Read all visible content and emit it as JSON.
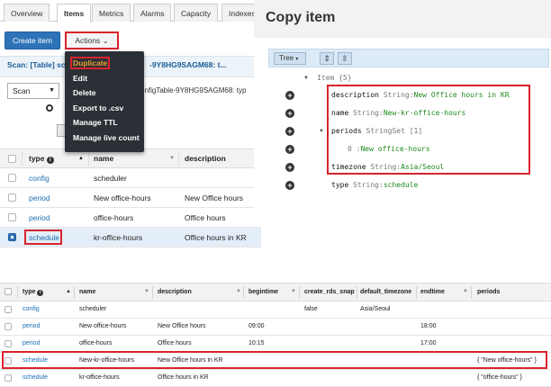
{
  "panel1": {
    "tabs": [
      "Overview",
      "Items",
      "Metrics",
      "Alarms",
      "Capacity",
      "Indexes"
    ],
    "create_item": "Create item",
    "actions": "Actions",
    "scan_title": "Scan: [Table] sche",
    "scan_title_tail": "-9Y8HG9SAGM68: t...",
    "scan_mode": "Scan",
    "scan_table": "onfigTable-9Y8HG9SAGM68: typ",
    "menu": [
      "Duplicate",
      "Edit",
      "Delete",
      "Export to .csv",
      "Manage TTL",
      "Manage live count"
    ],
    "columns": [
      "type",
      "name",
      "description"
    ],
    "rows": [
      {
        "type": "config",
        "name": "scheduler",
        "description": ""
      },
      {
        "type": "period",
        "name": "New office-hours",
        "description": "New Office hours"
      },
      {
        "type": "period",
        "name": "office-hours",
        "description": "Office hours"
      },
      {
        "type": "schedule",
        "name": "kr-office-hours",
        "description": "Office hours in KR"
      }
    ]
  },
  "panel2": {
    "title": "Copy item",
    "view_mode": "Tree",
    "root_label": "Item {5}",
    "attrs": [
      {
        "key": "description",
        "type": "String",
        "value": "New Office hours in KR"
      },
      {
        "key": "name",
        "type": "String",
        "value": "New-kr-office-hours"
      },
      {
        "key": "periods",
        "type": "StringSet [1]",
        "value": ""
      },
      {
        "key": "0",
        "type": "",
        "value": "New office-hours"
      },
      {
        "key": "timezone",
        "type": "String",
        "value": "Asia/Seoul"
      },
      {
        "key": "type",
        "type": "String",
        "value": "schedule"
      }
    ]
  },
  "panel3": {
    "columns": [
      "type",
      "name",
      "description",
      "begintime",
      "create_rds_snap",
      "default_timezone",
      "endtime",
      "periods"
    ],
    "rows": [
      {
        "type": "config",
        "name": "scheduler",
        "description": "",
        "begintime": "",
        "create_rds_snap": "false",
        "default_timezone": "Asia/Seoul",
        "endtime": "",
        "periods": ""
      },
      {
        "type": "period",
        "name": "New office-hours",
        "description": "New Office hours",
        "begintime": "09:00",
        "create_rds_snap": "",
        "default_timezone": "",
        "endtime": "18:00",
        "periods": ""
      },
      {
        "type": "period",
        "name": "office-hours",
        "description": "Office hours",
        "begintime": "10:15",
        "create_rds_snap": "",
        "default_timezone": "",
        "endtime": "17:00",
        "periods": ""
      },
      {
        "type": "schedule",
        "name": "New-kr-office-hours",
        "description": "New Office hours in KR",
        "begintime": "",
        "create_rds_snap": "",
        "default_timezone": "",
        "endtime": "",
        "periods": "{ \"New office-hours\" }"
      },
      {
        "type": "schedule",
        "name": "kr-office-hours",
        "description": "Office hours in KR",
        "begintime": "",
        "create_rds_snap": "",
        "default_timezone": "",
        "endtime": "",
        "periods": "{ \"office-hours\" }"
      }
    ]
  },
  "colors": {
    "accent": "#2e73b8",
    "highlight": "#d9232d",
    "link": "#1a6fb5",
    "value_green": "#1e8a1e"
  }
}
